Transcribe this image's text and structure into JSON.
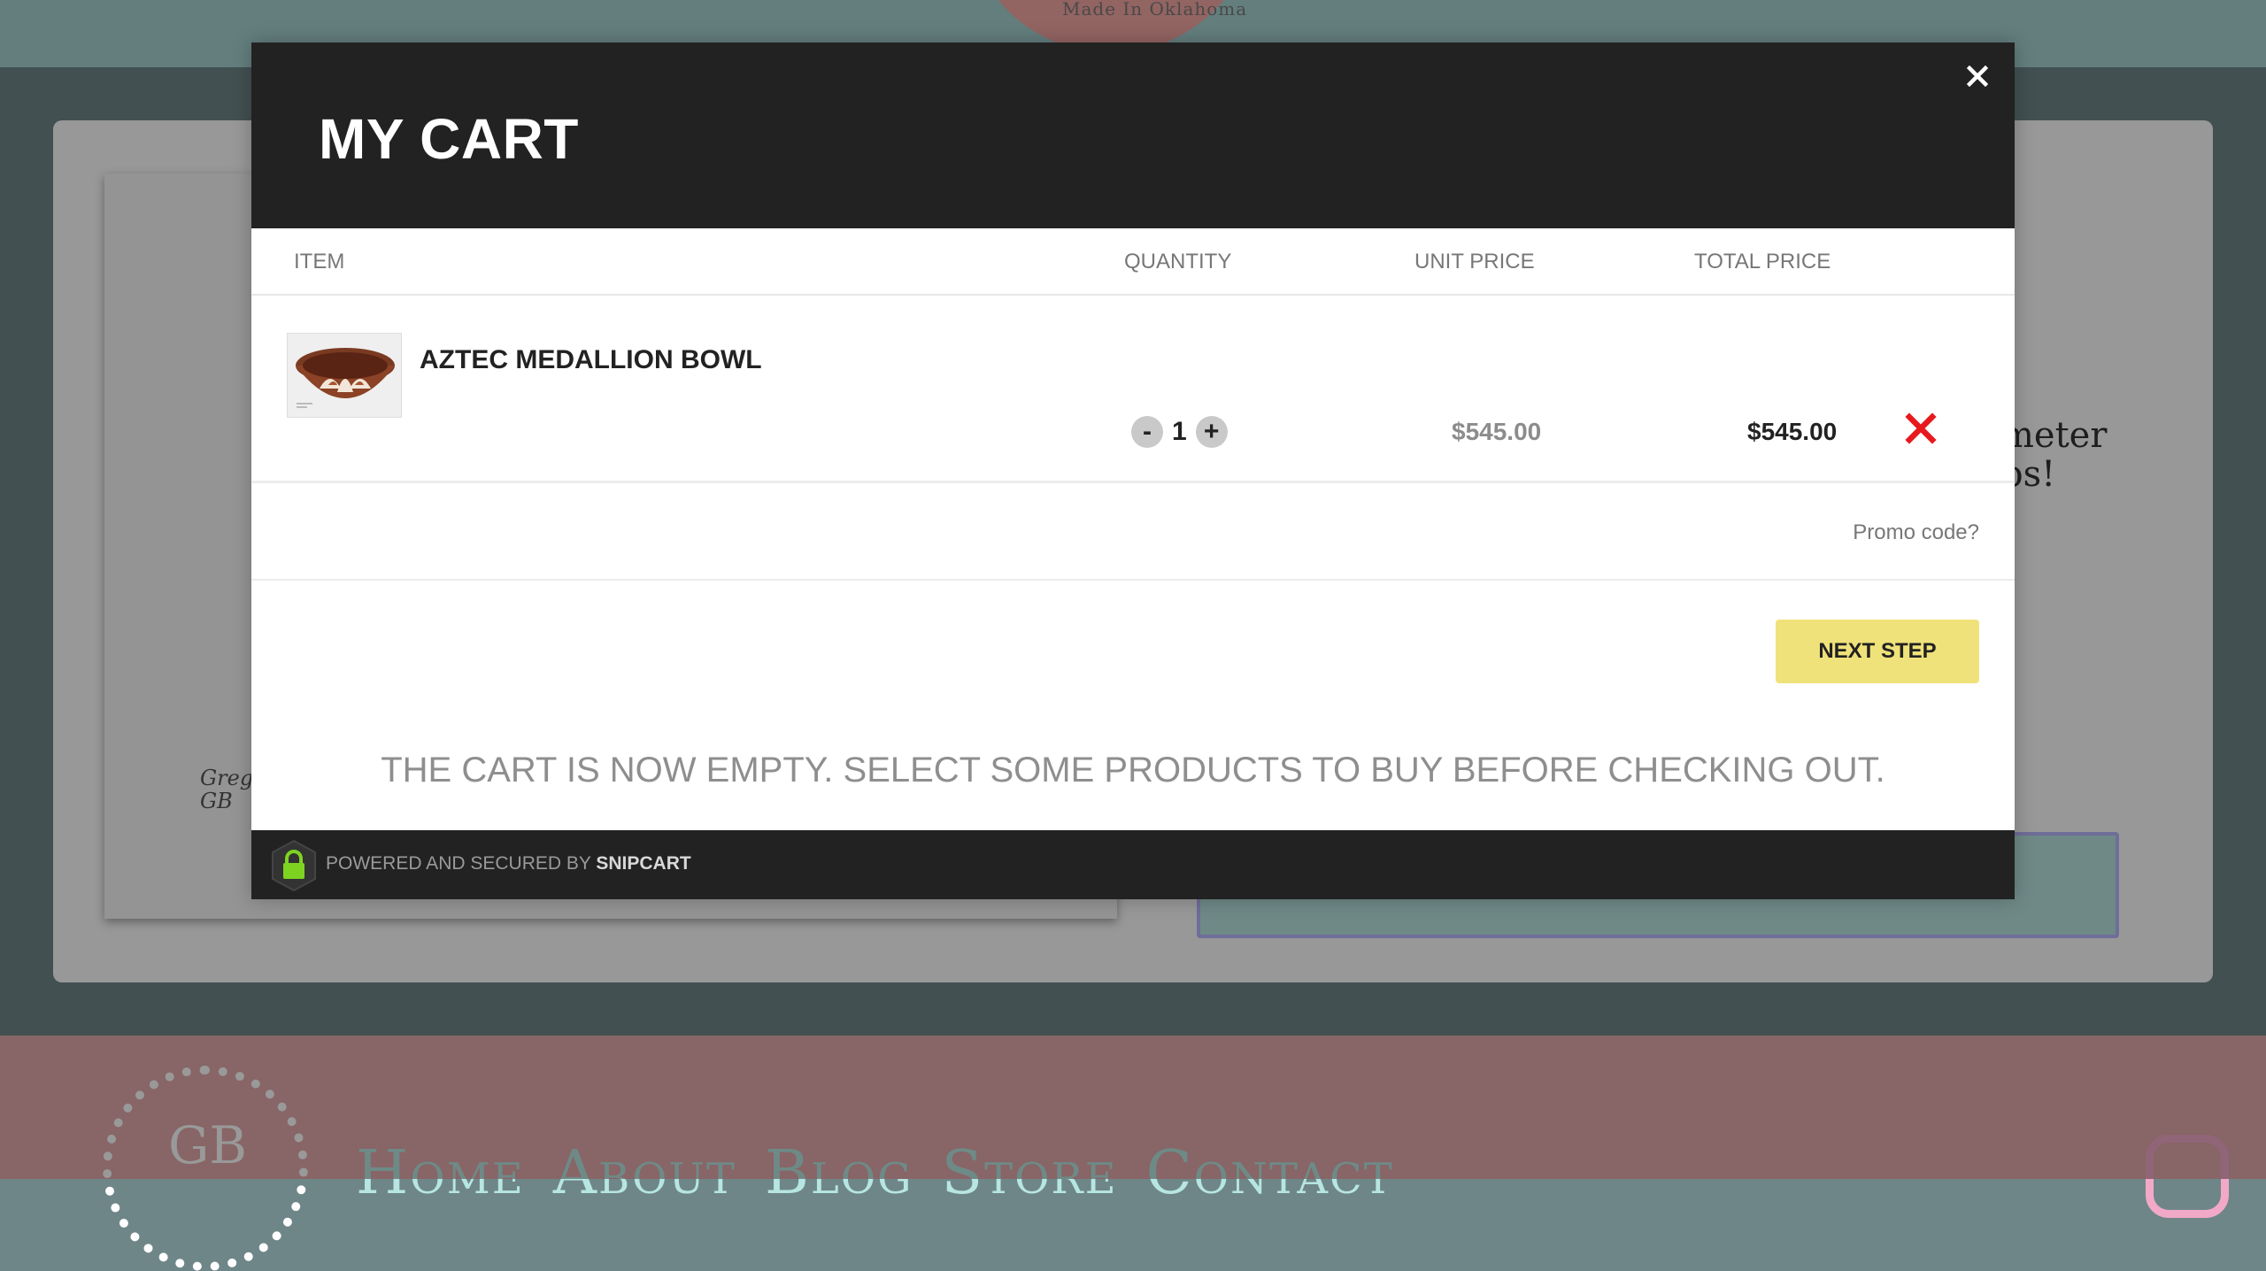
{
  "background": {
    "top_logo_text": "Made In Oklahoma",
    "signature": "Greg\nGB",
    "side_text": "meter\nps!",
    "footer_logo": "GB",
    "nav": [
      "Home",
      "About",
      "Blog",
      "Store",
      "Contact"
    ]
  },
  "cart": {
    "title": "MY CART",
    "columns": {
      "item": "ITEM",
      "quantity": "QUANTITY",
      "unit_price": "UNIT PRICE",
      "total_price": "TOTAL PRICE"
    },
    "items": [
      {
        "name": "AZTEC MEDALLION BOWL",
        "quantity": "1",
        "unit_price": "$545.00",
        "total_price": "$545.00",
        "decrement_label": "-",
        "increment_label": "+"
      }
    ],
    "promo_label": "Promo code?",
    "next_step_label": "NEXT STEP",
    "empty_message": "THE CART IS NOW EMPTY. SELECT SOME PRODUCTS TO BUY BEFORE CHECKING OUT.",
    "footer": {
      "powered_prefix": "POWERED AND SECURED BY",
      "powered_brand": "SNIPCART"
    }
  },
  "icons": {
    "close": "close-icon",
    "remove": "remove-x-icon",
    "lock": "lock-icon"
  },
  "colors": {
    "header_bg": "#222222",
    "next_button": "#f0e27a",
    "remove": "#e8191d",
    "lock": "#7ed321"
  }
}
